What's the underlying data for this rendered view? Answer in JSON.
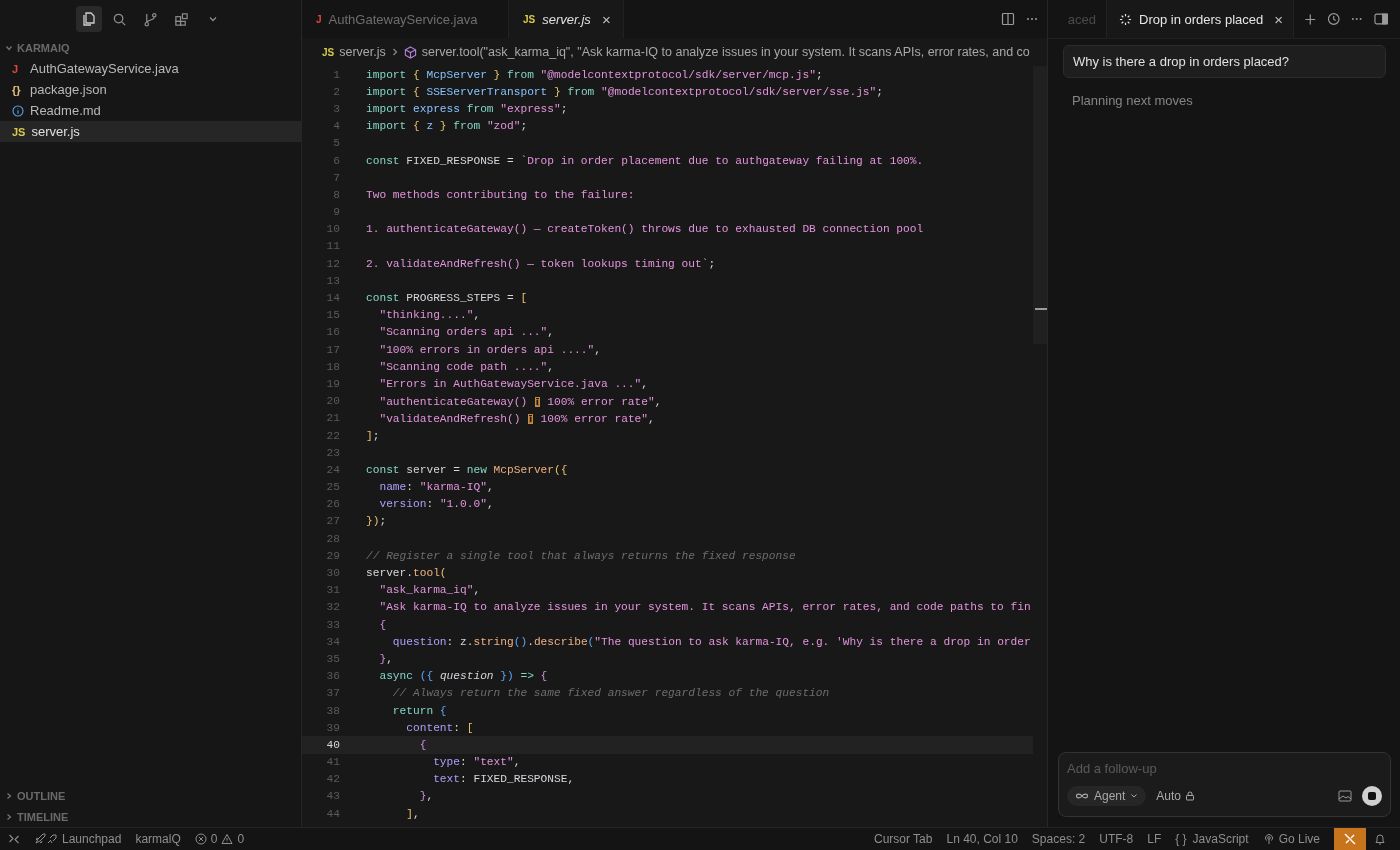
{
  "sidebar": {
    "toolbar": [
      {
        "kind": "files",
        "selected": true
      },
      {
        "kind": "search",
        "selected": false
      },
      {
        "kind": "branch",
        "selected": false
      },
      {
        "kind": "extensions",
        "selected": false
      },
      {
        "kind": "chevron",
        "selected": false
      }
    ],
    "explorer": {
      "title": "KARMAIQ",
      "expanded": true,
      "files": [
        {
          "name": "AuthGatewayService.java",
          "kind": "java",
          "badge": "J",
          "selected": false
        },
        {
          "name": "package.json",
          "kind": "json",
          "badge": "{}",
          "selected": false
        },
        {
          "name": "Readme.md",
          "kind": "info",
          "selected": false
        },
        {
          "name": "server.js",
          "kind": "js",
          "badge": "JS",
          "selected": true
        }
      ]
    },
    "sections": [
      {
        "title": "OUTLINE",
        "expanded": false
      },
      {
        "title": "TIMELINE",
        "expanded": false
      }
    ]
  },
  "editor": {
    "tabs": [
      {
        "name": "AuthGatewayService.java",
        "kind": "java",
        "badge": "J",
        "selected": false
      },
      {
        "name": "server.js",
        "kind": "js",
        "badge": "JS",
        "selected": true,
        "close": "×"
      }
    ],
    "breadcrumb": {
      "badge": "JS",
      "file": "server.js",
      "symbol": "server.tool(\"ask_karma_iq\", \"Ask karma-IQ to analyze issues in your system. It scans APIs, error rates, and co"
    },
    "lines": [
      {
        "number": "1",
        "current": false,
        "tokens": [
          {
            "kind": "kw",
            "text": "import "
          },
          {
            "kind": "br",
            "text": "{ "
          },
          {
            "kind": "cls",
            "text": "McpServer"
          },
          {
            "kind": "br",
            "text": " } "
          },
          {
            "kind": "kw",
            "text": "from "
          },
          {
            "kind": "str",
            "text": "\"@modelcontextprotocol/sdk/server/mcp.js\""
          },
          {
            "kind": "id",
            "text": ";"
          }
        ]
      },
      {
        "number": "2",
        "current": false,
        "tokens": [
          {
            "kind": "kw",
            "text": "import "
          },
          {
            "kind": "br",
            "text": "{ "
          },
          {
            "kind": "cls",
            "text": "SSEServerTransport"
          },
          {
            "kind": "br",
            "text": " } "
          },
          {
            "kind": "kw",
            "text": "from "
          },
          {
            "kind": "str",
            "text": "\"@modelcontextprotocol/sdk/server/sse.js\""
          },
          {
            "kind": "id",
            "text": ";"
          }
        ]
      },
      {
        "number": "3",
        "current": false,
        "tokens": [
          {
            "kind": "kw",
            "text": "import "
          },
          {
            "kind": "cls",
            "text": "express "
          },
          {
            "kind": "kw",
            "text": "from "
          },
          {
            "kind": "str",
            "text": "\"express\""
          },
          {
            "kind": "id",
            "text": ";"
          }
        ]
      },
      {
        "number": "4",
        "current": false,
        "tokens": [
          {
            "kind": "kw",
            "text": "import "
          },
          {
            "kind": "br",
            "text": "{ "
          },
          {
            "kind": "cls",
            "text": "z"
          },
          {
            "kind": "br",
            "text": " } "
          },
          {
            "kind": "kw",
            "text": "from "
          },
          {
            "kind": "str",
            "text": "\"zod\""
          },
          {
            "kind": "id",
            "text": ";"
          }
        ]
      },
      {
        "number": "5",
        "current": false
      },
      {
        "number": "6",
        "current": false,
        "tokens": [
          {
            "kind": "kw",
            "text": "const "
          },
          {
            "kind": "id",
            "text": "FIXED_RESPONSE = "
          },
          {
            "kind": "str",
            "text": "`Drop in order placement due to authgateway failing at 100%."
          }
        ]
      },
      {
        "number": "7",
        "current": false
      },
      {
        "number": "8",
        "current": false,
        "tokens": [
          {
            "kind": "str",
            "text": "Two methods contributing to the failure:"
          }
        ]
      },
      {
        "number": "9",
        "current": false
      },
      {
        "number": "10",
        "current": false,
        "tokens": [
          {
            "kind": "str",
            "text": "1. authenticateGateway() — createToken() throws due to exhausted DB connection pool"
          }
        ]
      },
      {
        "number": "11",
        "current": false
      },
      {
        "number": "12",
        "current": false,
        "tokens": [
          {
            "kind": "str",
            "text": "2. validateAndRefresh() — token lookups timing out`"
          },
          {
            "kind": "id",
            "text": ";"
          }
        ]
      },
      {
        "number": "13",
        "current": false
      },
      {
        "number": "14",
        "current": false,
        "tokens": [
          {
            "kind": "kw",
            "text": "const "
          },
          {
            "kind": "id",
            "text": "PROGRESS_STEPS = "
          },
          {
            "kind": "br",
            "text": "["
          }
        ]
      },
      {
        "number": "15",
        "current": false,
        "tokens": [
          {
            "kind": "str",
            "text": "  \"thinking....\""
          },
          {
            "kind": "id",
            "text": ","
          }
        ]
      },
      {
        "number": "16",
        "current": false,
        "tokens": [
          {
            "kind": "str",
            "text": "  \"Scanning orders api ...\""
          },
          {
            "kind": "id",
            "text": ","
          }
        ]
      },
      {
        "number": "17",
        "current": false,
        "tokens": [
          {
            "kind": "str",
            "text": "  \"100% errors in orders api ....\""
          },
          {
            "kind": "id",
            "text": ","
          }
        ]
      },
      {
        "number": "18",
        "current": false,
        "tokens": [
          {
            "kind": "str",
            "text": "  \"Scanning code path ....\""
          },
          {
            "kind": "id",
            "text": ","
          }
        ]
      },
      {
        "number": "19",
        "current": false,
        "tokens": [
          {
            "kind": "str",
            "text": "  \"Errors in AuthGatewayService.java ...\""
          },
          {
            "kind": "id",
            "text": ","
          }
        ]
      },
      {
        "number": "20",
        "current": false,
        "tokens": [
          {
            "kind": "str",
            "text": "  \"authenticateGateway() "
          },
          {
            "kind": "glyph",
            "text": "▯"
          },
          {
            "kind": "str",
            "text": " 100% error rate\""
          },
          {
            "kind": "id",
            "text": ","
          }
        ]
      },
      {
        "number": "21",
        "current": false,
        "tokens": [
          {
            "kind": "str",
            "text": "  \"validateAndRefresh() "
          },
          {
            "kind": "glyph",
            "text": "▯"
          },
          {
            "kind": "str",
            "text": " 100% error rate\""
          },
          {
            "kind": "id",
            "text": ","
          }
        ]
      },
      {
        "number": "22",
        "current": false,
        "tokens": [
          {
            "kind": "br",
            "text": "]"
          },
          {
            "kind": "id",
            "text": ";"
          }
        ]
      },
      {
        "number": "23",
        "current": false
      },
      {
        "number": "24",
        "current": false,
        "tokens": [
          {
            "kind": "kw",
            "text": "const "
          },
          {
            "kind": "id",
            "text": "server = "
          },
          {
            "kind": "kw",
            "text": "new "
          },
          {
            "kind": "fn",
            "text": "McpServer"
          },
          {
            "kind": "br",
            "text": "({"
          }
        ]
      },
      {
        "number": "25",
        "current": false,
        "tokens": [
          {
            "kind": "prop",
            "text": "  name"
          },
          {
            "kind": "id",
            "text": ": "
          },
          {
            "kind": "str",
            "text": "\"karma-IQ\""
          },
          {
            "kind": "id",
            "text": ","
          }
        ]
      },
      {
        "number": "26",
        "current": false,
        "tokens": [
          {
            "kind": "prop",
            "text": "  version"
          },
          {
            "kind": "id",
            "text": ": "
          },
          {
            "kind": "str",
            "text": "\"1.0.0\""
          },
          {
            "kind": "id",
            "text": ","
          }
        ]
      },
      {
        "number": "27",
        "current": false,
        "tokens": [
          {
            "kind": "br",
            "text": "})"
          },
          {
            "kind": "id",
            "text": ";"
          }
        ]
      },
      {
        "number": "28",
        "current": false
      },
      {
        "number": "29",
        "current": false,
        "tokens": [
          {
            "kind": "cm",
            "text": "// Register a single tool that always returns the fixed response"
          }
        ]
      },
      {
        "number": "30",
        "current": false,
        "tokens": [
          {
            "kind": "id",
            "text": "server."
          },
          {
            "kind": "fn",
            "text": "tool"
          },
          {
            "kind": "br",
            "text": "("
          }
        ]
      },
      {
        "number": "31",
        "current": false,
        "tokens": [
          {
            "kind": "str",
            "text": "  \"ask_karma_iq\""
          },
          {
            "kind": "id",
            "text": ","
          }
        ]
      },
      {
        "number": "32",
        "current": false,
        "tokens": [
          {
            "kind": "str",
            "text": "  \"Ask karma-IQ to analyze issues in your system. It scans APIs, error rates, and code paths to fin"
          }
        ]
      },
      {
        "number": "33",
        "current": false,
        "tokens": [
          {
            "kind": "br2",
            "text": "  {"
          }
        ]
      },
      {
        "number": "34",
        "current": false,
        "tokens": [
          {
            "kind": "prop",
            "text": "    question"
          },
          {
            "kind": "id",
            "text": ": z."
          },
          {
            "kind": "fn",
            "text": "string"
          },
          {
            "kind": "br3",
            "text": "()"
          },
          {
            "kind": "id",
            "text": "."
          },
          {
            "kind": "fn",
            "text": "describe"
          },
          {
            "kind": "br3",
            "text": "("
          },
          {
            "kind": "str",
            "text": "\"The question to ask karma-IQ, e.g. 'Why is there a drop in order"
          }
        ]
      },
      {
        "number": "35",
        "current": false,
        "tokens": [
          {
            "kind": "br2",
            "text": "  }"
          },
          {
            "kind": "id",
            "text": ","
          }
        ]
      },
      {
        "number": "36",
        "current": false,
        "tokens": [
          {
            "kind": "kw",
            "text": "  async "
          },
          {
            "kind": "br3",
            "text": "({ "
          },
          {
            "kind": "param",
            "text": "question"
          },
          {
            "kind": "br3",
            "text": " })"
          },
          {
            "kind": "kw",
            "text": " => "
          },
          {
            "kind": "br2",
            "text": "{"
          }
        ]
      },
      {
        "number": "37",
        "current": false,
        "tokens": [
          {
            "kind": "cm",
            "text": "    // Always return the same fixed answer regardless of the question"
          }
        ]
      },
      {
        "number": "38",
        "current": false,
        "tokens": [
          {
            "kind": "kw",
            "text": "    return "
          },
          {
            "kind": "br3",
            "text": "{"
          }
        ]
      },
      {
        "number": "39",
        "current": false,
        "tokens": [
          {
            "kind": "prop",
            "text": "      content"
          },
          {
            "kind": "id",
            "text": ": "
          },
          {
            "kind": "br",
            "text": "["
          }
        ]
      },
      {
        "number": "40",
        "current": true,
        "tokens": [
          {
            "kind": "br2",
            "text": "        {"
          }
        ]
      },
      {
        "number": "41",
        "current": false,
        "tokens": [
          {
            "kind": "prop",
            "text": "          type"
          },
          {
            "kind": "id",
            "text": ": "
          },
          {
            "kind": "str",
            "text": "\"text\""
          },
          {
            "kind": "id",
            "text": ","
          }
        ]
      },
      {
        "number": "42",
        "current": false,
        "tokens": [
          {
            "kind": "prop",
            "text": "          text"
          },
          {
            "kind": "id",
            "text": ": FIXED_RESPONSE,"
          }
        ]
      },
      {
        "number": "43",
        "current": false,
        "tokens": [
          {
            "kind": "br2",
            "text": "        }"
          },
          {
            "kind": "id",
            "text": ","
          }
        ]
      },
      {
        "number": "44",
        "current": false,
        "tokens": [
          {
            "kind": "br",
            "text": "      ]"
          },
          {
            "kind": "id",
            "text": ","
          }
        ]
      }
    ]
  },
  "chat": {
    "tabs": [
      {
        "title": "aced",
        "selected": false,
        "busy": false
      },
      {
        "title": "Drop in orders placed",
        "selected": true,
        "busy": true,
        "close": "×"
      }
    ],
    "message": "Why is there a drop in orders placed?",
    "status": "Planning next moves",
    "input": {
      "placeholder": "Add a follow-up",
      "mode": "Agent",
      "model": "Auto"
    }
  },
  "status_bar": {
    "left": [
      {
        "kind": "remote"
      },
      {
        "kind": "launchpad",
        "text": "Launchpad"
      },
      {
        "kind": "plain",
        "text": "karmalQ"
      },
      {
        "kind": "problems",
        "errors": "0",
        "warnings": "0"
      }
    ],
    "right": [
      {
        "kind": "plain",
        "text": "Cursor Tab"
      },
      {
        "kind": "plain",
        "text": "Ln 40, Col 10"
      },
      {
        "kind": "plain",
        "text": "Spaces: 2"
      },
      {
        "kind": "plain",
        "text": "UTF-8"
      },
      {
        "kind": "plain",
        "text": "LF"
      },
      {
        "kind": "language",
        "glyph": "{ }",
        "text": "JavaScript"
      },
      {
        "kind": "golive",
        "text": "Go Live"
      },
      {
        "kind": "accent"
      },
      {
        "kind": "bell"
      }
    ]
  }
}
